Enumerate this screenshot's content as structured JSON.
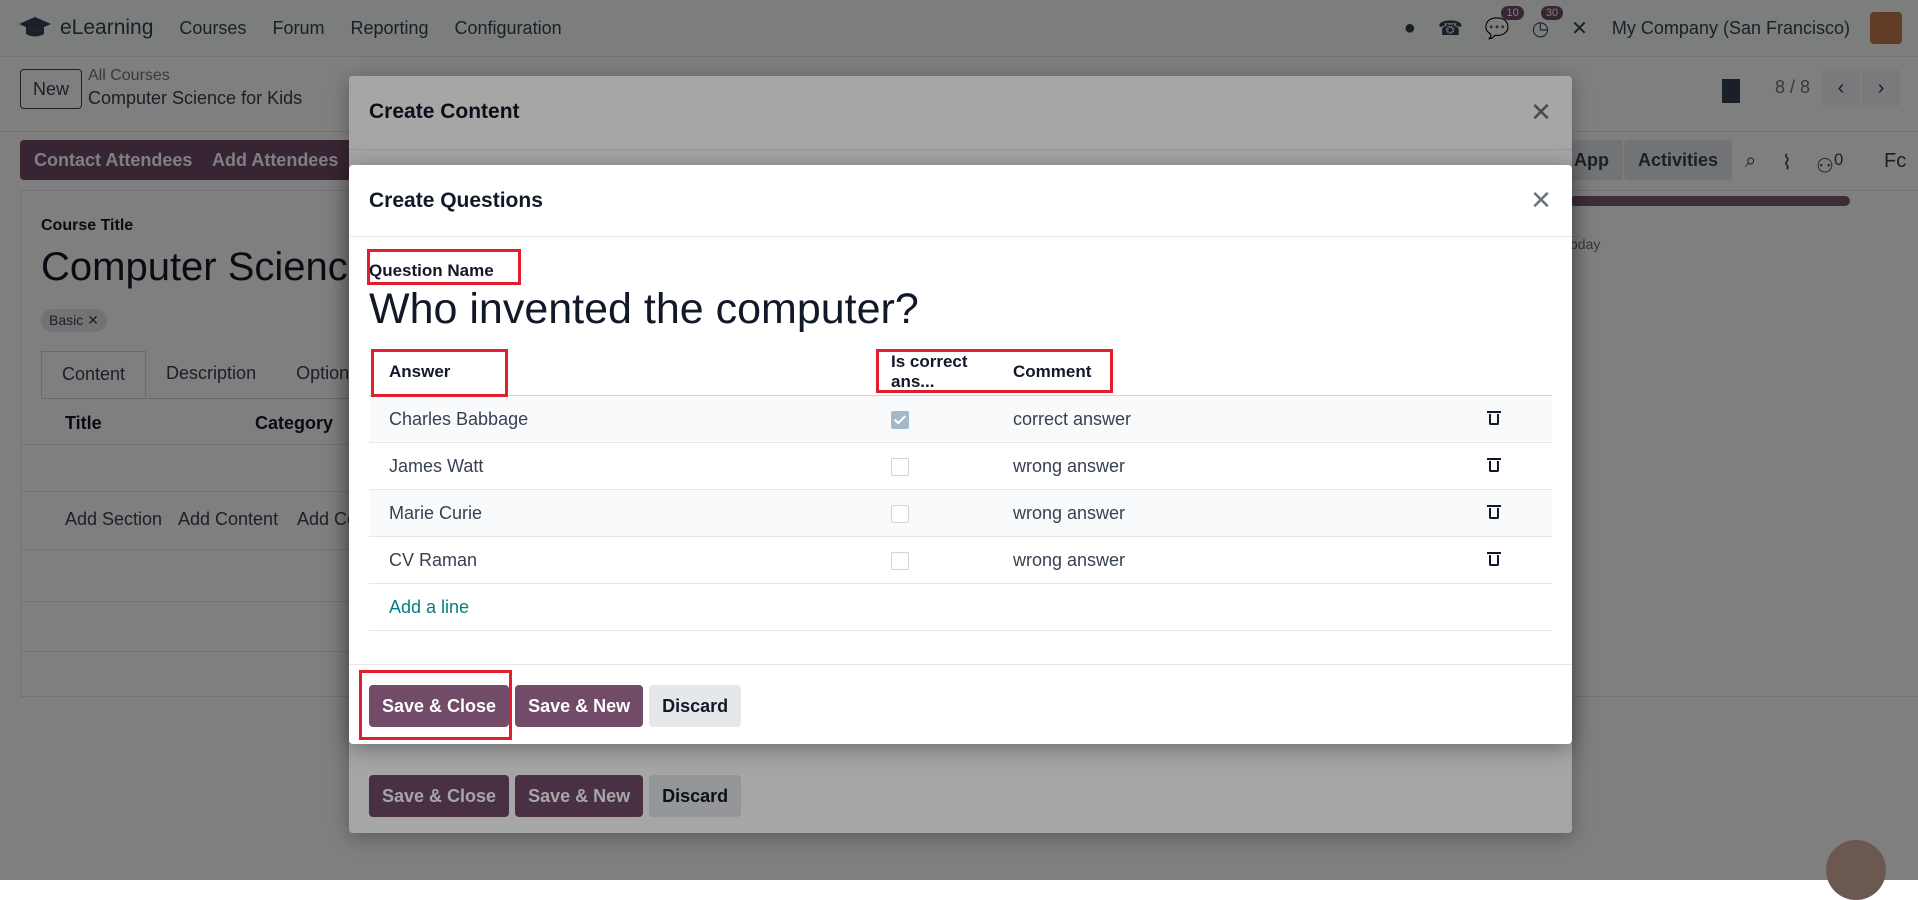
{
  "topbar": {
    "app_name": "eLearning",
    "menu": [
      "Courses",
      "Forum",
      "Reporting",
      "Configuration"
    ],
    "messages_badge": "10",
    "activities_badge": "30",
    "company": "My Company (San Francisco)"
  },
  "control": {
    "new_label": "New",
    "breadcrumb_parent": "All Courses",
    "breadcrumb_current": "Computer Science for Kids",
    "pager": "8 / 8"
  },
  "actions": {
    "contact_attendees": "Contact Attendees",
    "add_attendees": "Add Attendees",
    "app": "App",
    "activities": "Activities",
    "follower_count": "0",
    "fc": "Fc"
  },
  "form": {
    "course_title_label": "Course Title",
    "course_title": "Computer Scienc",
    "tag": "Basic ✕",
    "tabs": [
      "Content",
      "Description",
      "Option"
    ],
    "columns": [
      "Title",
      "Category"
    ],
    "links": [
      "Add Section",
      "Add Content",
      "Add Ce"
    ],
    "today": "oday"
  },
  "outer_modal": {
    "title": "Create Content",
    "buttons": {
      "save_close": "Save & Close",
      "save_new": "Save & New",
      "discard": "Discard"
    }
  },
  "inner_modal": {
    "title": "Create Questions",
    "question_label": "Question Name",
    "question": "Who invented the computer?",
    "columns": {
      "answer": "Answer",
      "is_correct": "Is correct ans...",
      "comment": "Comment"
    },
    "rows": [
      {
        "answer": "Charles Babbage",
        "correct": true,
        "comment": "correct answer"
      },
      {
        "answer": "James Watt",
        "correct": false,
        "comment": "wrong answer"
      },
      {
        "answer": "Marie Curie",
        "correct": false,
        "comment": "wrong answer"
      },
      {
        "answer": "CV Raman",
        "correct": false,
        "comment": "wrong answer"
      }
    ],
    "add_line": "Add a line",
    "buttons": {
      "save_close": "Save & Close",
      "save_new": "Save & New",
      "discard": "Discard"
    }
  },
  "colors": {
    "primary": "#714b67",
    "link": "#017e84",
    "highlight": "#e11d2e"
  }
}
